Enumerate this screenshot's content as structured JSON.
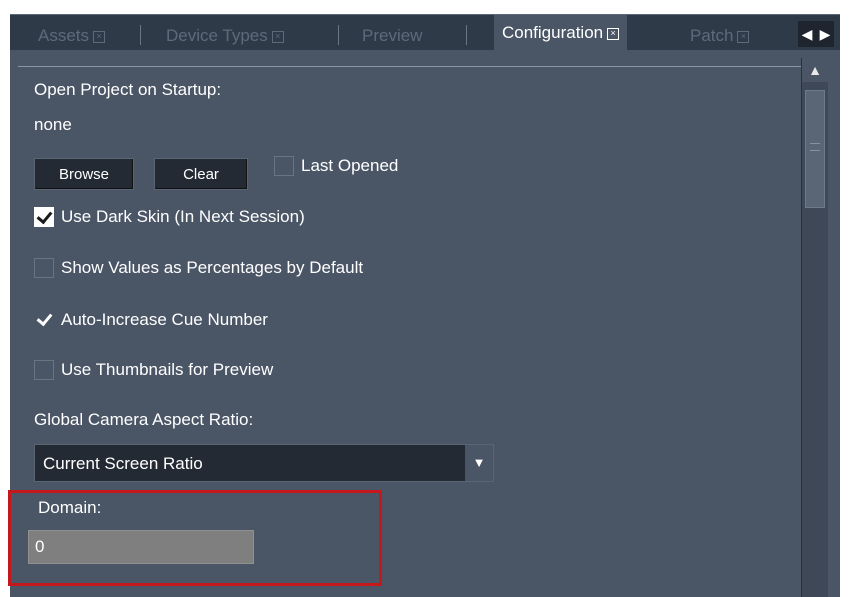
{
  "tabs": [
    {
      "label": "Assets",
      "closable": true,
      "active": false
    },
    {
      "label": "Device Types",
      "closable": true,
      "active": false
    },
    {
      "label": "Preview",
      "closable": false,
      "active": false
    },
    {
      "label": "Configuration",
      "closable": true,
      "active": true
    },
    {
      "label": "Patch",
      "closable": true,
      "active": false
    }
  ],
  "tab_nav": {
    "left_icon": "triangle-left",
    "right_icon": "triangle-right"
  },
  "config": {
    "open_project_label": "Open Project on Startup:",
    "open_project_value": "none",
    "browse_label": "Browse",
    "clear_label": "Clear",
    "last_opened_label": "Last Opened",
    "last_opened_checked": false,
    "dark_skin_label": "Use Dark Skin (In Next Session)",
    "dark_skin_checked": true,
    "percentages_label": "Show Values as Percentages by Default",
    "percentages_checked": false,
    "auto_increase_label": "Auto-Increase Cue Number",
    "auto_increase_checked": true,
    "thumbnails_label": "Use Thumbnails for Preview",
    "thumbnails_checked": false,
    "aspect_ratio_label": "Global Camera Aspect Ratio:",
    "aspect_ratio_value": "Current Screen Ratio",
    "domain_label": "Domain:",
    "domain_value": "0"
  },
  "colors": {
    "panel_bg": "#4a5566",
    "tabbar_bg": "#2f3a48",
    "highlight_border": "#c4181c",
    "input_bg": "#7f7f7f"
  }
}
